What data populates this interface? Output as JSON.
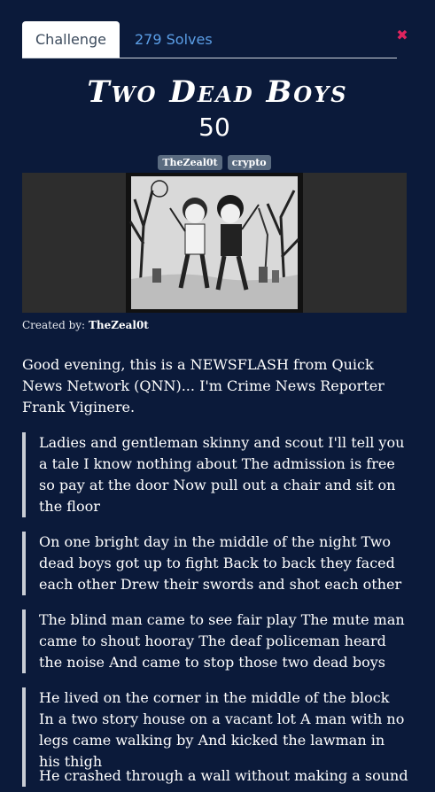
{
  "tabs": {
    "challenge": "Challenge",
    "solves": "279 Solves"
  },
  "challenge": {
    "title": "Two Dead Boys",
    "points": "50",
    "tags": [
      "TheZeal0t",
      "crypto"
    ],
    "created_by_label": "Created by:",
    "author": "TheZeal0t",
    "intro": "Good evening, this is a NEWSFLASH from Quick News Network (QNN)... I'm Crime News Reporter Frank Viginere.",
    "verses": [
      "Ladies and gentleman skinny and scout I'll tell you a tale I know nothing about The admission is free so pay at the door Now pull out a chair and sit on the floor",
      "On one bright day in the middle of the night Two dead boys got up to fight Back to back they faced each other Drew their swords and shot each other",
      "The blind man came to see fair play The mute man came to shout hooray The deaf policeman heard the noise And came to stop those two dead boys",
      "He lived on the corner in the middle of the block In a two story house on a vacant lot A man with no legs came walking by And kicked the lawman in his thigh",
      "He crashed through a wall without making a sound"
    ]
  },
  "colors": {
    "background": "#0b1a3a",
    "link": "#5b9ee6",
    "close": "#e0245e",
    "tag": "#5a6b80"
  }
}
